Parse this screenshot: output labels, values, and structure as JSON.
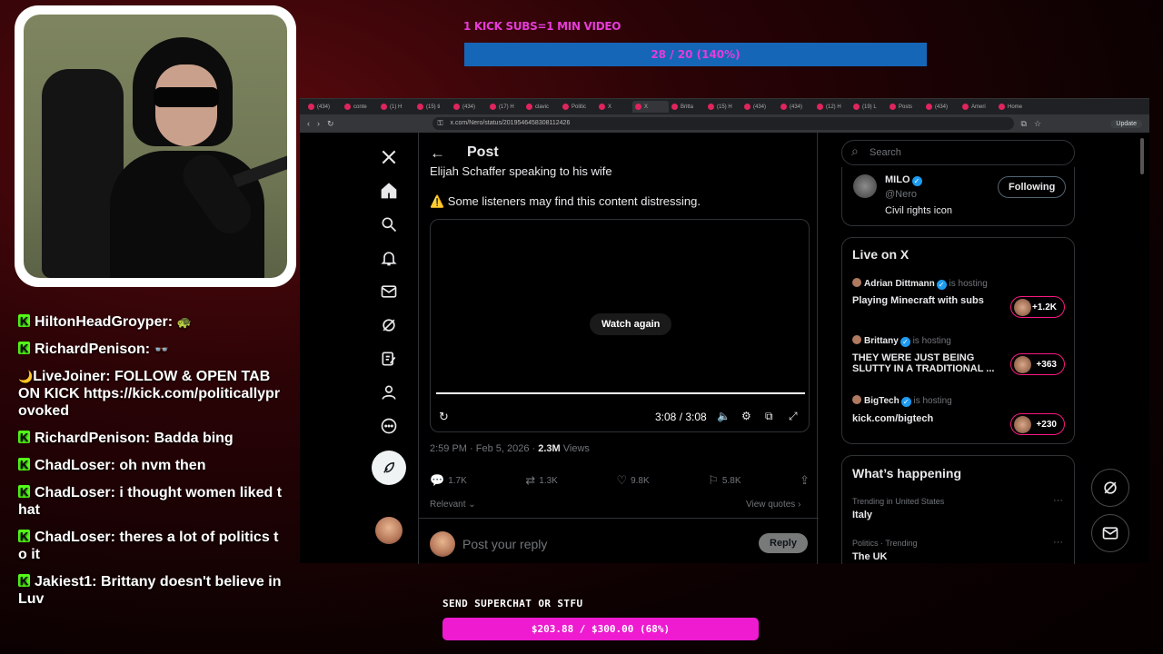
{
  "overlay": {
    "sub_goal": {
      "label": "1 KICK SUBS=1 MIN VIDEO",
      "progress_text": "28 / 20 (140%)",
      "progress_fraction": 1.4
    },
    "superchat_goal": {
      "label": "SEND SUPERCHAT OR STFU",
      "progress_text": "$203.88 / $300.00 (68%)",
      "progress_fraction": 0.68
    }
  },
  "chat": [
    {
      "user": "HiltonHeadGroyper:",
      "text": "🐢"
    },
    {
      "user": "RichardPenison:",
      "text": "👓"
    },
    {
      "user": "LiveJoiner:",
      "text": "FOLLOW & OPEN TAB ON KICK https://kick.com/politicallyprovoked"
    },
    {
      "user": "RichardPenison:",
      "text": "Badda bing"
    },
    {
      "user": "ChadLoser:",
      "text": "oh nvm then"
    },
    {
      "user": "ChadLoser:",
      "text": "i thought women liked that"
    },
    {
      "user": "ChadLoser:",
      "text": "theres a lot of politics to it"
    },
    {
      "user": "Jakiest1:",
      "text": "Brittany doesn't believe inLuv"
    }
  ],
  "browser": {
    "url": "x.com/Nero/status/2019546458308112426",
    "update_label": "Update",
    "tabs": [
      "(434)",
      "conte",
      "(1) H",
      "(15) ti",
      "(434)",
      "(17) H",
      "clavic",
      "Politic",
      "X",
      "X",
      "Britta",
      "(15) H",
      "(434)",
      "(434)",
      "(12) H",
      "(19) L",
      "Posts",
      "(434)",
      "Ameri",
      "Home"
    ]
  },
  "post": {
    "header": "Post",
    "text": "Elijah Schaffer speaking to his wife",
    "warning": "⚠️ Some listeners may find this content distressing.",
    "watch_again": "Watch again",
    "video_time": "3:08 / 3:08",
    "timestamp": "2:59 PM · Feb 5, 2026 · ",
    "views_count": "2.3M",
    "views_label": " Views",
    "replies": "1.7K",
    "reposts": "1.3K",
    "likes": "9.8K",
    "bookmarks": "5.8K",
    "relevant": "Relevant",
    "view_quotes": "View quotes",
    "reply_placeholder": "Post your reply",
    "reply_button": "Reply"
  },
  "sidebar": {
    "search_placeholder": "Search",
    "profile": {
      "name": "MILO",
      "handle": "@Nero",
      "bio": "Civil rights icon",
      "follow_label": "Following"
    },
    "live": {
      "title": "Live on X",
      "items": [
        {
          "host": "Adrian Dittmann",
          "suffix": " is hosting",
          "stream": "Playing Minecraft with subs",
          "count": "+1.2K"
        },
        {
          "host": "Brittany",
          "suffix": " is hosting",
          "stream": "THEY WERE JUST BEING SLUTTY IN A TRADITIONAL ...",
          "count": "+363"
        },
        {
          "host": "BigTech",
          "suffix": " is hosting",
          "stream": "kick.com/bigtech",
          "count": "+230"
        }
      ]
    },
    "happening": {
      "title": "What’s happening",
      "trends": [
        {
          "context": "Trending in United States",
          "name": "Italy"
        },
        {
          "context": "Politics · Trending",
          "name": "The UK"
        }
      ]
    }
  },
  "icons": [
    "x-logo-icon",
    "home-icon",
    "search-icon",
    "bell-icon",
    "mail-icon",
    "grok-icon",
    "edit-icon",
    "profile-icon",
    "more-icon",
    "compose-icon"
  ]
}
